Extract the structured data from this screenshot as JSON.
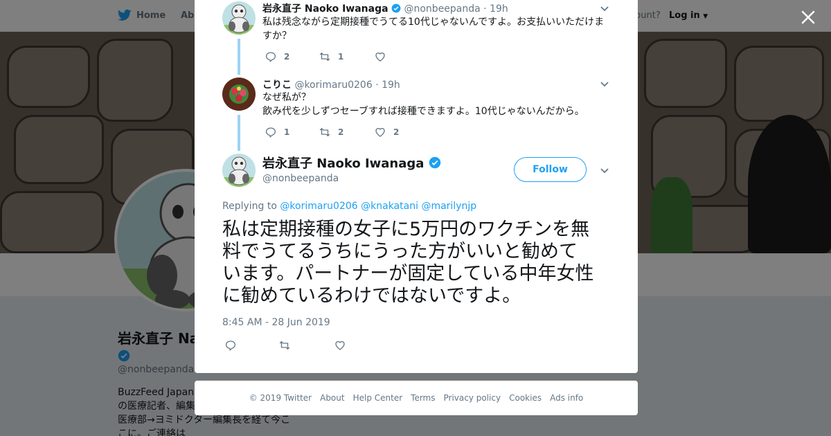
{
  "nav": {
    "home_label": "Home",
    "about_label": "Abo",
    "account_text": "ccount?",
    "login_label": "Log in"
  },
  "profile": {
    "name": "岩永直子 Na",
    "handle": "@nonbeepanda",
    "bio_lines": [
      "BuzzFeed Japan",
      "の医療記者、編集",
      "医療部→ヨミドクター編集長を経て今こ",
      "こに。ご連絡は"
    ]
  },
  "thread": [
    {
      "name": "岩永直子 Naoko Iwanaga",
      "verified": true,
      "handle": "@nonbeepanda",
      "time": "19h",
      "text_lines": [
        "私は残念ながら定期接種でうてる10代じゃないんですよ。お支払いいただけま",
        "すか？"
      ],
      "replies": "2",
      "retweets": "1",
      "likes": ""
    },
    {
      "name": "こりこ",
      "verified": false,
      "handle": "@korimaru0206",
      "time": "19h",
      "text_lines": [
        "なぜ私が？",
        "飲み代を少しずつセーブすれば接種できますよ。10代じゃないんだから。"
      ],
      "replies": "1",
      "retweets": "2",
      "likes": "2"
    }
  ],
  "main_tweet": {
    "name": "岩永直子 Naoko Iwanaga",
    "handle": "@nonbeepanda",
    "follow_label": "Follow",
    "replying_prefix": "Replying to",
    "mentions": [
      "@korimaru0206",
      "@knakatani",
      "@marilynjp"
    ],
    "text_lines": [
      "私は定期接種の女子に5万円のワクチンを無",
      "料でうてるうちにうった方がいいと勧めて",
      "います。パートナーが固定している中年女性",
      "に勧めているわけではないですよ。"
    ],
    "timestamp": "8:45 AM - 28 Jun 2019"
  },
  "footer": {
    "links": [
      "© 2019 Twitter",
      "About",
      "Help Center",
      "Terms",
      "Privacy policy",
      "Cookies",
      "Ads info"
    ]
  },
  "colors": {
    "accent": "#1da1f2",
    "thread_line": "#9cd3f5",
    "muted_text": "#657786"
  }
}
